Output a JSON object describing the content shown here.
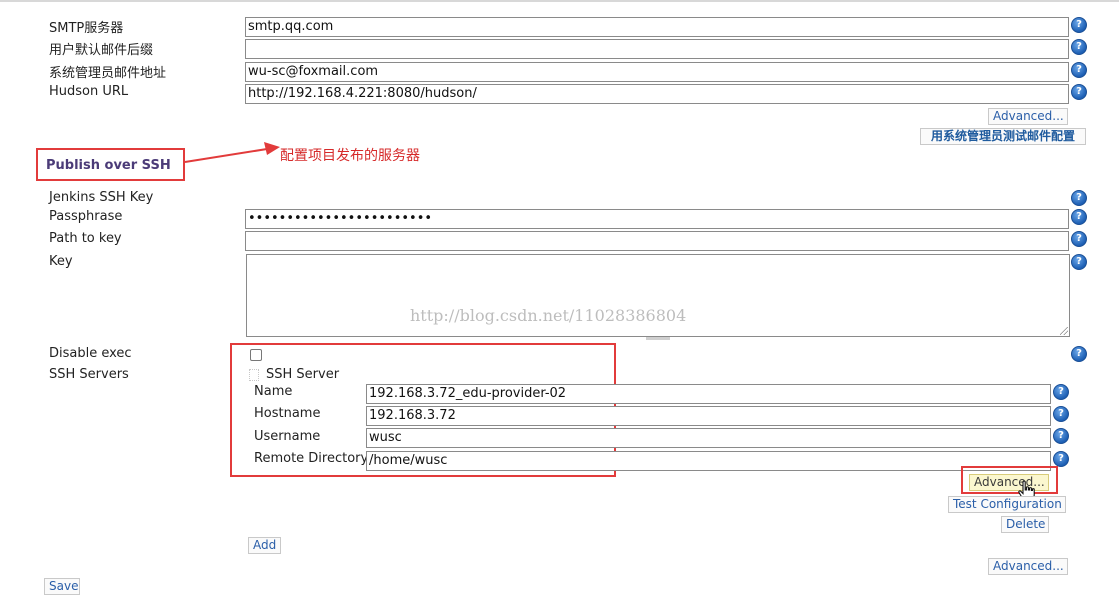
{
  "email": {
    "smtp_label": "SMTP服务器",
    "smtp_value": "smtp.qq.com",
    "suffix_label": "用户默认邮件后缀",
    "suffix_value": "",
    "admin_label": "系统管理员邮件地址",
    "admin_value": "wu-sc@foxmail.com",
    "hudson_label": "Hudson URL",
    "hudson_value": "http://192.168.4.221:8080/hudson/",
    "advanced_label": "Advanced...",
    "test_mail_label": "用系统管理员测试邮件配置"
  },
  "annotation": {
    "text": "配置项目发布的服务器",
    "color": "#d62a2a"
  },
  "ssh": {
    "section_title": "Publish over SSH",
    "key_label": "Jenkins SSH Key",
    "passphrase_label": "Passphrase",
    "passphrase_value": "••••••••••••••••••••••••",
    "path_label": "Path to key",
    "path_value": "",
    "key_field_label": "Key",
    "key_value": "",
    "disable_exec_label": "Disable exec",
    "servers_label": "SSH Servers",
    "server_header": "SSH Server",
    "name_label": "Name",
    "name_value": "192.168.3.72_edu-provider-02",
    "hostname_label": "Hostname",
    "hostname_value": "192.168.3.72",
    "username_label": "Username",
    "username_value": "wusc",
    "remote_dir_label": "Remote Directory",
    "remote_dir_value": "/home/wusc",
    "server_advanced_label": "Advanced...",
    "test_config_label": "Test Configuration",
    "delete_label": "Delete",
    "add_label": "Add",
    "advanced_label": "Advanced..."
  },
  "watermark": "http://blog.csdn.net/11028386804",
  "save_label": "Save",
  "help_glyph": "?",
  "icons": {
    "help": "help-icon",
    "cursor": "hand-pointer-icon",
    "arrow": "red-arrow-icon"
  },
  "colors": {
    "highlight_red": "#e23b3b",
    "link_blue": "#2a5ea8",
    "section_purple": "#4b3b78"
  }
}
